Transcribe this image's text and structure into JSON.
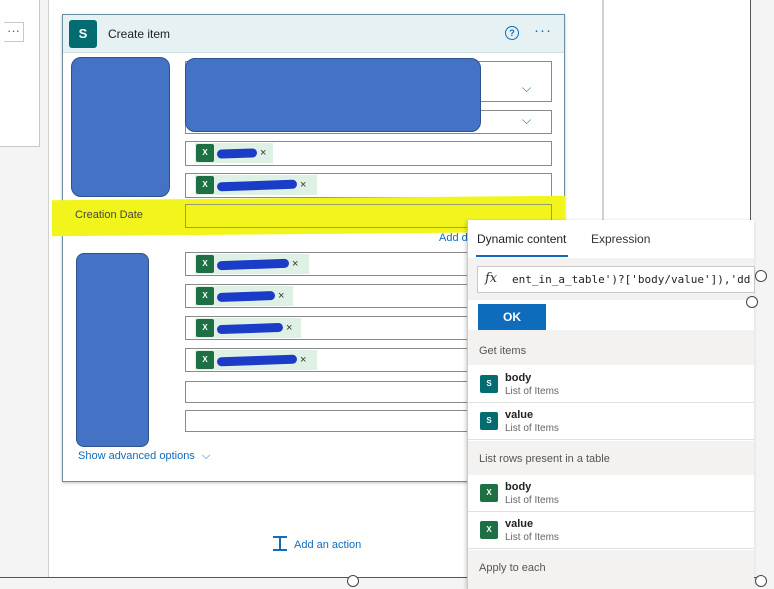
{
  "left_card": {
    "more_label": "···"
  },
  "card": {
    "title": "Create item",
    "logo": "S",
    "help_label": "?",
    "more_label": "···",
    "creation_date_label": "Creation Date",
    "add_link": "Add d",
    "show_advanced": "Show advanced options",
    "chevron": "⌵",
    "token_remove": "×"
  },
  "add_action": {
    "label": "Add an action"
  },
  "dynamic_panel": {
    "tabs": [
      "Dynamic content",
      "Expression"
    ],
    "active_tab": "Dynamic content",
    "expression_text": "ent_in_a_table')?['body/value']),'dd-M",
    "ok_label": "OK",
    "sections": [
      {
        "title": "Get items",
        "items": [
          {
            "name": "body",
            "sub": "List of Items"
          },
          {
            "name": "value",
            "sub": "List of Items"
          }
        ]
      },
      {
        "title": "List rows present in a table",
        "items": [
          {
            "name": "body",
            "sub": "List of Items"
          },
          {
            "name": "value",
            "sub": "List of Items"
          }
        ]
      },
      {
        "title": "Apply to each",
        "items": []
      }
    ]
  },
  "colors": {
    "accent": "#0f6cbd",
    "sharepoint": "#036c70",
    "excel": "#1d7044",
    "highlight": "#f2f51c",
    "redaction": "#4472c4"
  },
  "icons": {
    "sharepoint": "sharepoint-icon",
    "excel": "excel-icon",
    "function": "fx-icon",
    "add_action": "add-action-icon"
  }
}
